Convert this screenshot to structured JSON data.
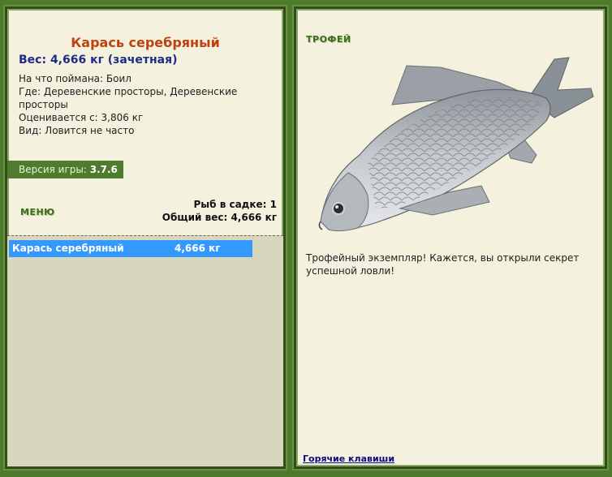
{
  "fish": {
    "name": "Карась серебряный",
    "weight_line": "Вес: 4,666 кг (зачетная)",
    "bait": "На что поймана: Боил",
    "location": "Где: Деревенские просторы, Деревенские просторы",
    "value": "Оценивается с: 3,806 кг",
    "rarity": "Вид: Ловится не часто"
  },
  "version": {
    "label": "Версия игры: ",
    "number": "3.7.6"
  },
  "menu_label": "МЕНЮ",
  "keep": {
    "count_line": "Рыб в садке: 1",
    "total_line": "Общий вес: 4,666 кг"
  },
  "catch_list": [
    {
      "name": "Карась серебряный",
      "weight": "4,666 кг"
    }
  ],
  "trophy": {
    "label": "ТРОФЕЙ",
    "message": "Трофейный экземпляр! Кажется, вы открыли секрет успешной ловли!"
  },
  "hotkeys_label": "Горячие клавиши",
  "colors": {
    "background": "#4e7a2c",
    "panel": "#f4f2de",
    "fish_name": "#c0400f",
    "weight": "#1f2a8a",
    "selected_row": "#3399ff",
    "green_label": "#3c6a1e"
  }
}
